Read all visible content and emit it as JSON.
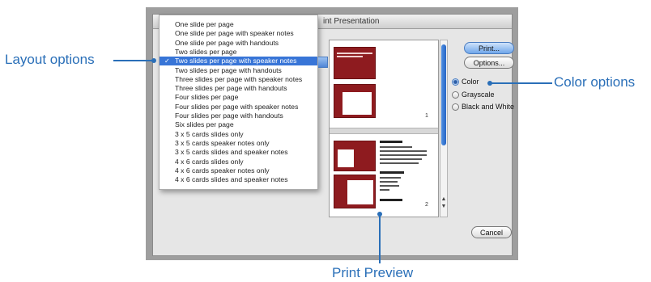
{
  "dialog": {
    "title": "int Presentation"
  },
  "layout_menu": {
    "items": [
      "One slide per page",
      "One slide per page with speaker notes",
      "One slide per page with handouts",
      "Two slides per page",
      "Two slides per page with speaker notes",
      "Two slides per page with handouts",
      "Three slides per page with speaker notes",
      "Three slides per page with handouts",
      "Four slides per page",
      "Four slides per page with speaker notes",
      "Four slides per page with handouts",
      "Six slides per page",
      "3 x 5 cards slides only",
      "3 x 5 cards speaker notes only",
      "3 x 5 cards slides and speaker notes",
      "4 x 6 cards slides only",
      "4 x 6 cards speaker notes only",
      "4 x 6 cards slides and speaker notes"
    ],
    "selected_index": 4,
    "checkmark": "✓"
  },
  "buttons": {
    "print": "Print...",
    "options": "Options...",
    "cancel": "Cancel"
  },
  "color_options": {
    "items": [
      "Color",
      "Grayscale",
      "Black and White"
    ],
    "selected_index": 0
  },
  "preview": {
    "page_numbers": [
      "1",
      "2"
    ]
  },
  "callouts": {
    "layout": "Layout options",
    "color": "Color options",
    "preview": "Print Preview"
  },
  "colors": {
    "accent": "#2a6fb8",
    "selection": "#3875d7",
    "slide": "#8e1b1f"
  }
}
